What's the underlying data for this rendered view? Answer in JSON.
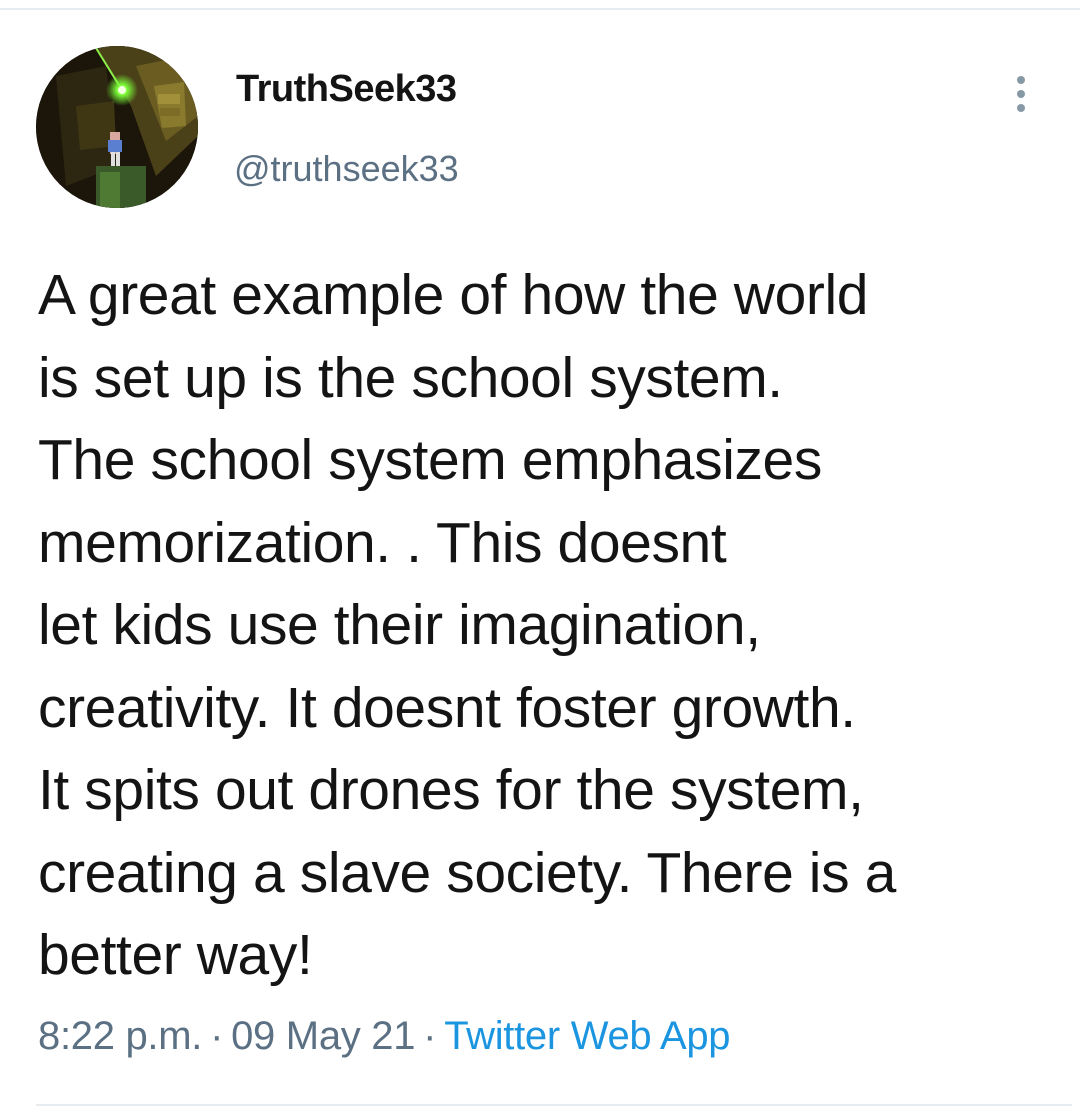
{
  "tweet": {
    "author": {
      "display_name": "TruthSeek33",
      "handle": "@truthseek33"
    },
    "text_lines": [
      "A great example of how the world",
      "is set up is the school system.",
      "The school system emphasizes",
      "memorization. . This doesnt",
      "let kids use their imagination,",
      "creativity. It doesnt foster growth.",
      "It spits out drones for the system,",
      "creating a slave society. There is a",
      "better way!"
    ],
    "time": "8:22 p.m.",
    "separator": "·",
    "date": "09 May 21",
    "source": "Twitter Web App"
  },
  "icons": {
    "more": "more-vertical-icon"
  },
  "colors": {
    "text": "#141414",
    "secondary": "#5b7083",
    "link": "#1b95e0",
    "divider": "#e6ecf0"
  }
}
